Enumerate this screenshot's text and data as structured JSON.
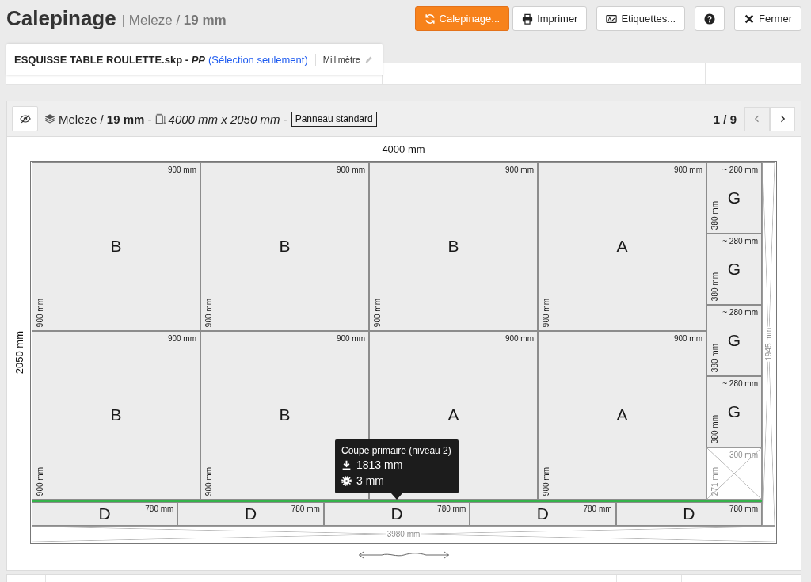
{
  "header": {
    "title": "Calepinage",
    "subtitle": "| Meleze / **19 mm**",
    "buttons": [
      {
        "kind": "refresh",
        "label": "Calepinage...",
        "primary": true
      },
      {
        "kind": "print",
        "label": "Imprimer",
        "primary": false
      },
      {
        "kind": "labels",
        "label": "Etiquettes...",
        "primary": false
      },
      {
        "kind": "help",
        "primary": false
      },
      {
        "kind": "close",
        "label": "Fermer",
        "primary": false
      }
    ]
  },
  "file_tab": {
    "name": "ESQUISSE TABLE ROULETTE.skp - *PP*",
    "scope_link": "(Sélection seulement)",
    "unit": "Millimètre"
  },
  "panel": {
    "material": "Meleze / **19 mm** -",
    "dimensions": "*4000 mm x 2050 mm* -",
    "panel_type": "Panneau standard",
    "pager": {
      "label": "1 / 9",
      "prev_disabled": true,
      "next_disabled": false
    }
  },
  "sheet": {
    "width_label": "4000 mm",
    "height_label": "2050 mm",
    "panel_rows": [
      [
        {
          "letter": "B",
          "width": "900 mm",
          "height": "900 mm"
        },
        {
          "letter": "B",
          "width": "900 mm",
          "height": "900 mm"
        },
        {
          "letter": "B",
          "width": "900 mm",
          "height": "900 mm"
        },
        {
          "letter": "A",
          "width": "900 mm",
          "height": "900 mm"
        }
      ],
      [
        {
          "letter": "B",
          "width": "900 mm",
          "height": "900 mm"
        },
        {
          "letter": "B",
          "width": "900 mm",
          "height": "900 mm"
        },
        {
          "letter": "A",
          "width": "900 mm"
        },
        {
          "letter": "A",
          "width": "900 mm",
          "height": "900 mm"
        }
      ]
    ],
    "side_pieces": [
      {
        "kind": "piece",
        "letter": "G",
        "width": "~ 280 mm",
        "height": "380 mm"
      },
      {
        "kind": "piece",
        "letter": "G",
        "width": "~ 280 mm",
        "height": "380 mm"
      },
      {
        "kind": "piece",
        "letter": "G",
        "width": "~ 280 mm",
        "height": "380 mm"
      },
      {
        "kind": "piece",
        "letter": "G",
        "width": "~ 280 mm",
        "height": "380 mm"
      },
      {
        "kind": "offcut",
        "width": "300 mm",
        "height": "271 mm"
      }
    ],
    "cut": {
      "highlighted": true,
      "tooltip": {
        "title": "Coupe primaire (niveau 2)",
        "position": "1813 mm",
        "kerf": "3 mm"
      }
    },
    "strip": [
      {
        "letter": "D",
        "width": "780 mm"
      },
      {
        "letter": "D",
        "width": "780 mm"
      },
      {
        "letter": "D",
        "width": "780 mm"
      },
      {
        "letter": "D",
        "width": "780 mm"
      },
      {
        "letter": "D",
        "width": "780 mm"
      }
    ],
    "side_offcut": "1945 mm",
    "bottom_offcut": "3980 mm"
  }
}
